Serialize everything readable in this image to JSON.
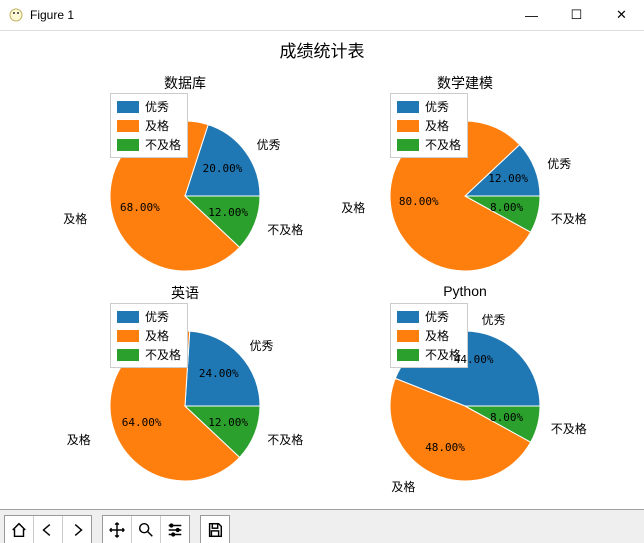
{
  "window": {
    "title": "Figure 1",
    "minimize": "—",
    "maximize": "☐",
    "close": "✕"
  },
  "main_title": "成绩统计表",
  "colors": {
    "c0": "#1f77b4",
    "c1": "#ff7f0e",
    "c2": "#2ca02c"
  },
  "legend_labels": [
    "优秀",
    "及格",
    "不及格"
  ],
  "slice_labels": [
    "优秀",
    "及格",
    "不及格"
  ],
  "chart_data": [
    {
      "type": "pie",
      "title": "数据库",
      "labels": [
        "优秀",
        "及格",
        "不及格"
      ],
      "values": [
        20.0,
        68.0,
        12.0
      ],
      "display": [
        "20.00%",
        "68.00%",
        "12.00%"
      ]
    },
    {
      "type": "pie",
      "title": "数学建模",
      "labels": [
        "优秀",
        "及格",
        "不及格"
      ],
      "values": [
        12.0,
        80.0,
        8.0
      ],
      "display": [
        "12.00%",
        "80.00%",
        "8.00%"
      ]
    },
    {
      "type": "pie",
      "title": "英语",
      "labels": [
        "优秀",
        "及格",
        "不及格"
      ],
      "values": [
        24.0,
        64.0,
        12.0
      ],
      "display": [
        "24.00%",
        "64.00%",
        "12.00%"
      ]
    },
    {
      "type": "pie",
      "title": "Python",
      "labels": [
        "优秀",
        "及格",
        "不及格"
      ],
      "values": [
        44.0,
        48.0,
        8.0
      ],
      "display": [
        "44.00%",
        "48.00%",
        "8.00%"
      ]
    }
  ],
  "toolbar": {
    "home": "home-icon",
    "back": "back-icon",
    "forward": "forward-icon",
    "pan": "pan-icon",
    "zoom": "zoom-icon",
    "configure": "configure-icon",
    "save": "save-icon"
  }
}
